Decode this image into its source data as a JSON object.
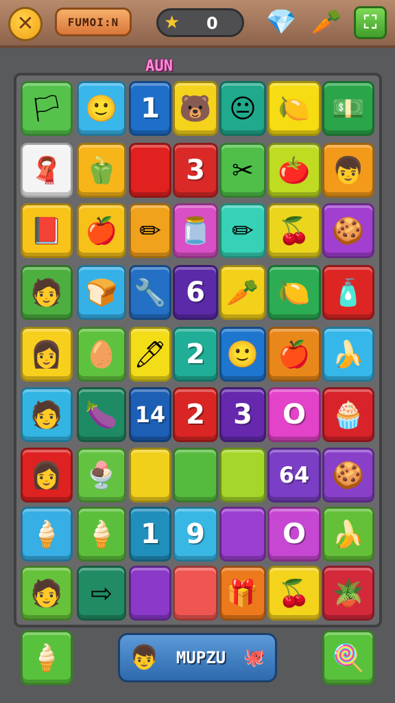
{
  "header": {
    "close_icon": "✕",
    "title_label": "FUMOI:N",
    "score": "0",
    "star_icon": "★",
    "gems_icon": "💎",
    "fruit_icon": "🥕",
    "menu_icon": "⛶"
  },
  "level_label": "AUN",
  "board": {
    "rows": [
      [
        {
          "bg": "#55c24b",
          "icon": "flag-icon",
          "glyph": "🏳"
        },
        {
          "bg": "#39b6ea",
          "icon": "face-icon",
          "glyph": "🙂"
        },
        {
          "bg": "#1e6fc9",
          "text": "1"
        },
        {
          "bg": "#f5d21c",
          "icon": "bear-icon",
          "glyph": "🐻"
        },
        {
          "bg": "#20a98c",
          "icon": "bald-face-icon",
          "glyph": "😐"
        },
        {
          "bg": "#f6dc12",
          "icon": "lemon-icon",
          "glyph": "🍋"
        },
        {
          "bg": "#2aa54a",
          "icon": "cash-stack-icon",
          "glyph": "💵"
        }
      ],
      [
        {
          "bg": "#f4f4f4",
          "icon": "red-cloth-icon",
          "glyph": "🧣"
        },
        {
          "bg": "#f7b51a",
          "icon": "red-bag-icon",
          "glyph": "🫑"
        },
        {
          "bg": "#e0211f",
          "text": ""
        },
        {
          "bg": "#d92a28",
          "text": "3"
        },
        {
          "bg": "#4fbf4a",
          "icon": "scissors-icon",
          "glyph": "✂"
        },
        {
          "bg": "#bfdc22",
          "icon": "tomato-icon",
          "glyph": "🍅"
        },
        {
          "bg": "#f39a1a",
          "icon": "boy-face-icon",
          "glyph": "👦"
        }
      ],
      [
        {
          "bg": "#f8c419",
          "icon": "book-icon",
          "glyph": "📕"
        },
        {
          "bg": "#f6c21a",
          "icon": "apple-icon",
          "glyph": "🍎"
        },
        {
          "bg": "#f1a21c",
          "icon": "crossed-pencils-icon",
          "glyph": "✏"
        },
        {
          "bg": "#d84fc6",
          "icon": "jar-icon",
          "glyph": "🫙"
        },
        {
          "bg": "#36d1b7",
          "icon": "pencil-icon",
          "glyph": "✏"
        },
        {
          "bg": "#ecd51d",
          "icon": "fruit-bunch-icon",
          "glyph": "🍒"
        },
        {
          "bg": "#a13fd1",
          "icon": "cookie-monster-icon",
          "glyph": "🍪"
        }
      ],
      [
        {
          "bg": "#4caf3f",
          "icon": "man-face-icon",
          "glyph": "🧑"
        },
        {
          "bg": "#36b1e8",
          "icon": "bread-icon",
          "glyph": "🍞"
        },
        {
          "bg": "#2370c4",
          "icon": "tools-icon",
          "glyph": "🔧"
        },
        {
          "bg": "#5b2aa8",
          "text": "6"
        },
        {
          "bg": "#f3d11a",
          "icon": "carrot-icon",
          "glyph": "🥕"
        },
        {
          "bg": "#2cad53",
          "icon": "lemon-icon",
          "glyph": "🍋"
        },
        {
          "bg": "#dd2624",
          "icon": "bottle-icon",
          "glyph": "🧴"
        }
      ],
      [
        {
          "bg": "#f7cf1d",
          "icon": "woman-face-icon",
          "glyph": "👩"
        },
        {
          "bg": "#5fc23e",
          "icon": "egg-face-icon",
          "glyph": "🥚"
        },
        {
          "bg": "#f3dc18",
          "icon": "marker-icon",
          "glyph": "🖊"
        },
        {
          "bg": "#20ae97",
          "text": "2"
        },
        {
          "bg": "#1e76cf",
          "icon": "smiley-icon",
          "glyph": "🙂"
        },
        {
          "bg": "#e9881a",
          "icon": "red-apple-icon",
          "glyph": "🍎"
        },
        {
          "bg": "#35b7ea",
          "icon": "banana-icon",
          "glyph": "🍌"
        }
      ],
      [
        {
          "bg": "#33b5e3",
          "icon": "man-face-icon",
          "glyph": "🧑"
        },
        {
          "bg": "#1f8b65",
          "icon": "eggplant-icon",
          "glyph": "🍆"
        },
        {
          "bg": "#1d5fb4",
          "text": "14"
        },
        {
          "bg": "#d92624",
          "text": "2"
        },
        {
          "bg": "#6629ae",
          "text": "3"
        },
        {
          "bg": "#e243c8",
          "text": "O"
        },
        {
          "bg": "#d8232a",
          "icon": "cupcake-icon",
          "glyph": "🧁"
        }
      ],
      [
        {
          "bg": "#de2222",
          "icon": "woman-face-icon",
          "glyph": "👩"
        },
        {
          "bg": "#63c340",
          "icon": "ice-cream-bowl-icon",
          "glyph": "🍨"
        },
        {
          "bg": "#f1d01c",
          "text": ""
        },
        {
          "bg": "#55bb3f",
          "text": ""
        },
        {
          "bg": "#a5d62a",
          "text": ""
        },
        {
          "bg": "#7a3fc4",
          "text": "64"
        },
        {
          "bg": "#8940c9",
          "icon": "cookie-icon",
          "glyph": "🍪"
        }
      ],
      [
        {
          "bg": "#37aee4",
          "icon": "popsicle-icon",
          "glyph": "🍦"
        },
        {
          "bg": "#5cbf3b",
          "icon": "popsicle-icon",
          "glyph": "🍦"
        },
        {
          "bg": "#208fbc",
          "text": "1"
        },
        {
          "bg": "#39b7e4",
          "text": "9"
        },
        {
          "bg": "#9b3fd0",
          "text": ""
        },
        {
          "bg": "#c648d2",
          "text": "O"
        },
        {
          "bg": "#63c038",
          "icon": "banana-icon",
          "glyph": "🍌"
        }
      ],
      [
        {
          "bg": "#66c23a",
          "icon": "man-face-icon",
          "glyph": "🧑"
        },
        {
          "bg": "#218c64",
          "icon": "arrow-right-icon",
          "glyph": "⇨"
        },
        {
          "bg": "#8a39c9",
          "text": ""
        },
        {
          "bg": "#ef5652",
          "text": ""
        },
        {
          "bg": "#ec7a1c",
          "icon": "pink-box-icon",
          "glyph": "🎁"
        },
        {
          "bg": "#f4d31c",
          "icon": "cherry-icon",
          "glyph": "🍒"
        },
        {
          "bg": "#d4283b",
          "icon": "plant-pot-icon",
          "glyph": "🪴"
        }
      ]
    ]
  },
  "footer": {
    "left_button_bg": "#59c23c",
    "left_button_glyph": "🍦",
    "name_face_glyph": "👦",
    "name_label": "MUPZU",
    "name_blob_glyph": "🐙",
    "right_button_bg": "#59c23c",
    "right_button_glyph": "🍭"
  }
}
